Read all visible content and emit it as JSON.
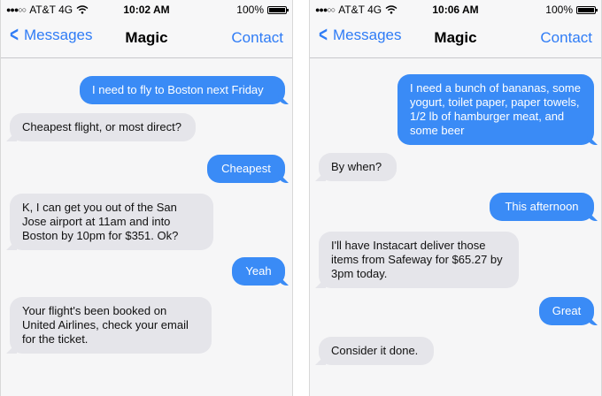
{
  "colors": {
    "accent": "#2f7cf6",
    "outgoing_bubble": "#3a8bf6",
    "incoming_bubble": "#e5e5ea"
  },
  "screens": [
    {
      "status": {
        "carrier": "AT&T 4G",
        "time": "10:02 AM",
        "battery": "100%"
      },
      "nav": {
        "back_label": "Messages",
        "title": "Magic",
        "contact_label": "Contact"
      },
      "messages": [
        {
          "dir": "out",
          "text": "I need to fly to Boston next Friday"
        },
        {
          "dir": "in",
          "text": "Cheapest flight, or most direct?"
        },
        {
          "dir": "out",
          "text": "Cheapest"
        },
        {
          "dir": "in",
          "text": "K, I can get you out of the San Jose airport at 11am and into Boston by 10pm for $351. Ok?"
        },
        {
          "dir": "out",
          "text": "Yeah"
        },
        {
          "dir": "in",
          "text": "Your flight's been booked on United Airlines, check your email for the ticket."
        }
      ]
    },
    {
      "status": {
        "carrier": "AT&T 4G",
        "time": "10:06 AM",
        "battery": "100%"
      },
      "nav": {
        "back_label": "Messages",
        "title": "Magic",
        "contact_label": "Contact"
      },
      "messages": [
        {
          "dir": "out",
          "text": "I need a bunch of bananas, some yogurt, toilet paper, paper towels, 1/2 lb of hamburger meat, and some beer"
        },
        {
          "dir": "in",
          "text": "By when?"
        },
        {
          "dir": "out",
          "text": "This afternoon"
        },
        {
          "dir": "in",
          "text": "I'll have Instacart deliver those items from Safeway for $65.27 by 3pm today."
        },
        {
          "dir": "out",
          "text": "Great"
        },
        {
          "dir": "in",
          "text": "Consider it done."
        }
      ]
    }
  ]
}
